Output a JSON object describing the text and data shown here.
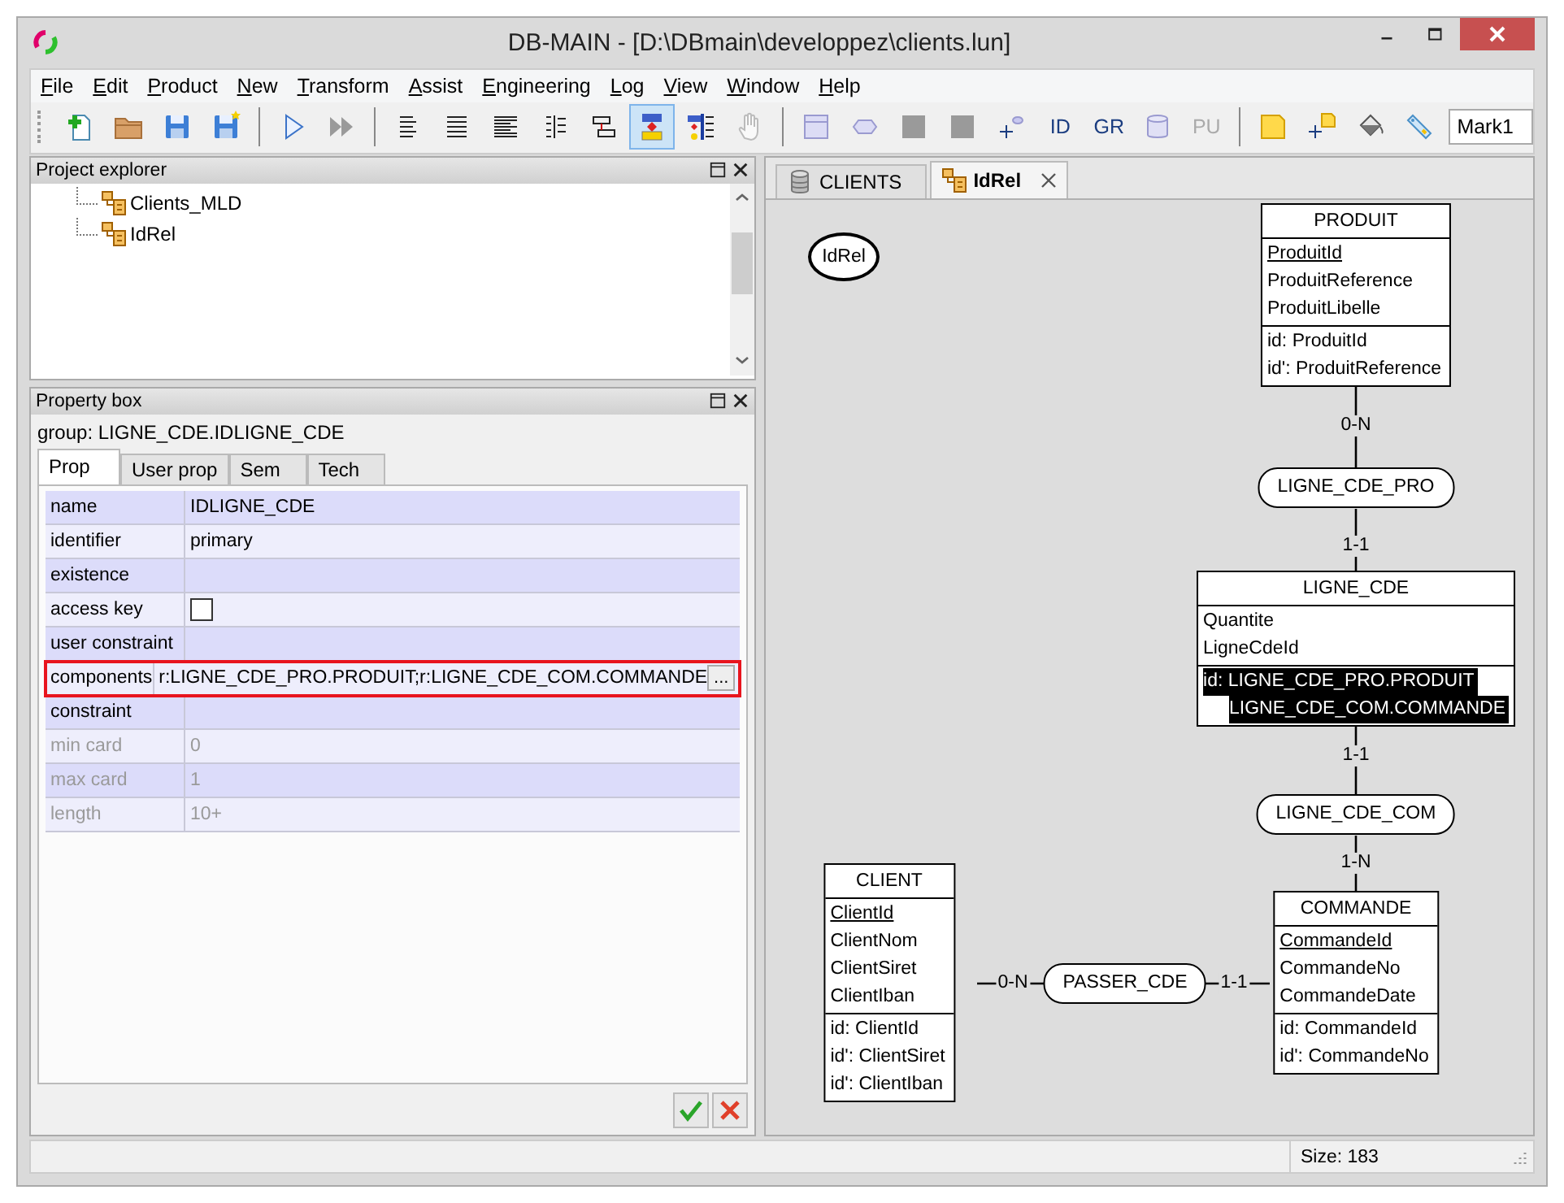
{
  "window": {
    "title": "DB-MAIN  - [D:\\DBmain\\developpez\\clients.lun]"
  },
  "menu": [
    {
      "label": "File"
    },
    {
      "label": "Edit"
    },
    {
      "label": "Product"
    },
    {
      "label": "New"
    },
    {
      "label": "Transform"
    },
    {
      "label": "Assist"
    },
    {
      "label": "Engineering"
    },
    {
      "label": "Log"
    },
    {
      "label": "View"
    },
    {
      "label": "Window"
    },
    {
      "label": "Help"
    }
  ],
  "toolbar": [
    {
      "kind": "icon",
      "selected": false,
      "disabled": false
    },
    {
      "kind": "icon",
      "selected": false,
      "disabled": false
    },
    {
      "kind": "icon",
      "selected": false,
      "disabled": false
    },
    {
      "kind": "icon",
      "selected": false,
      "disabled": false
    },
    {
      "kind": "separator"
    },
    {
      "kind": "icon",
      "selected": false,
      "disabled": false
    },
    {
      "kind": "icon",
      "selected": false,
      "disabled": false
    },
    {
      "kind": "separator"
    },
    {
      "kind": "icon",
      "selected": false,
      "disabled": false
    },
    {
      "kind": "icon",
      "selected": false,
      "disabled": false
    },
    {
      "kind": "icon",
      "selected": false,
      "disabled": false
    },
    {
      "kind": "icon",
      "selected": false,
      "disabled": false
    },
    {
      "kind": "icon",
      "selected": false,
      "disabled": false
    },
    {
      "kind": "icon",
      "selected": true,
      "disabled": false
    },
    {
      "kind": "icon",
      "selected": false,
      "disabled": false
    },
    {
      "kind": "icon",
      "selected": false,
      "disabled": true
    },
    {
      "kind": "separator"
    },
    {
      "kind": "icon",
      "selected": false,
      "disabled": false
    },
    {
      "kind": "icon",
      "selected": false,
      "disabled": false
    },
    {
      "kind": "icon",
      "selected": false,
      "disabled": false
    },
    {
      "kind": "icon",
      "selected": false,
      "disabled": false
    },
    {
      "kind": "icon",
      "selected": false,
      "disabled": false
    },
    {
      "kind": "text",
      "label": "ID",
      "selected": false,
      "disabled": false
    },
    {
      "kind": "text",
      "label": "GR",
      "selected": false,
      "disabled": false
    },
    {
      "kind": "icon",
      "selected": false,
      "disabled": false
    },
    {
      "kind": "text",
      "label": "PU",
      "selected": false,
      "disabled": true
    },
    {
      "kind": "separator"
    },
    {
      "kind": "icon",
      "selected": false,
      "disabled": false
    },
    {
      "kind": "icon",
      "selected": false,
      "disabled": false
    },
    {
      "kind": "icon",
      "selected": false,
      "disabled": false
    },
    {
      "kind": "icon",
      "selected": false,
      "disabled": false
    },
    {
      "kind": "field",
      "value": "Mark1"
    }
  ],
  "project_explorer": {
    "title": "Project explorer",
    "items": [
      {
        "label": "Clients_MLD"
      },
      {
        "label": "IdRel"
      }
    ]
  },
  "property_box": {
    "title": "Property box",
    "subject": "group: LIGNE_CDE.IDLIGNE_CDE",
    "tabs": [
      {
        "label": "Prop",
        "selected": true
      },
      {
        "label": "User prop",
        "selected": false
      },
      {
        "label": "Sem",
        "selected": false
      },
      {
        "label": "Tech",
        "selected": false
      }
    ],
    "rows": [
      {
        "kind": "text",
        "label": "name",
        "value": "IDLIGNE_CDE",
        "disabled": false,
        "highlighted": false
      },
      {
        "kind": "text",
        "label": "identifier",
        "value": "primary",
        "disabled": false,
        "highlighted": false
      },
      {
        "kind": "text",
        "label": "existence",
        "disabled": false,
        "highlighted": false
      },
      {
        "kind": "checkbox",
        "label": "access key",
        "checked": false,
        "disabled": false,
        "highlighted": false
      },
      {
        "kind": "text",
        "label": "user constraint",
        "disabled": false,
        "highlighted": false
      },
      {
        "kind": "list",
        "label": "components",
        "value": "r:LIGNE_CDE_PRO.PRODUIT;r:LIGNE_CDE_COM.COMMANDE",
        "button": "...",
        "disabled": false,
        "highlighted": true
      },
      {
        "kind": "text",
        "label": "constraint",
        "disabled": false,
        "highlighted": false
      },
      {
        "kind": "text",
        "label": "min card",
        "value": "0",
        "disabled": true,
        "highlighted": false
      },
      {
        "kind": "text",
        "label": "max card",
        "value": "1",
        "disabled": true,
        "highlighted": false
      },
      {
        "kind": "text",
        "label": "length",
        "value": "10+",
        "disabled": true,
        "highlighted": false
      }
    ]
  },
  "editor_tabs": [
    {
      "label": "CLIENTS",
      "selected": false,
      "closable": false
    },
    {
      "label": "IdRel",
      "selected": true,
      "closable": true
    }
  ],
  "diagram": {
    "schema": "IdRel",
    "entities": [
      {
        "name": "PRODUIT",
        "attributes": [
          {
            "name": "ProduitId",
            "primary": true
          },
          {
            "name": "ProduitReference",
            "primary": false
          },
          {
            "name": "ProduitLibelle",
            "primary": false
          }
        ],
        "constraints": [
          {
            "lines": [
              "id: ProduitId"
            ],
            "selected": false
          },
          {
            "lines": [
              "id': ProduitReference"
            ],
            "selected": false
          }
        ]
      },
      {
        "name": "LIGNE_CDE",
        "attributes": [
          {
            "name": "Quantite",
            "primary": false
          },
          {
            "name": "LigneCdeId",
            "primary": false
          }
        ],
        "constraints": [
          {
            "lines": [
              "id: LIGNE_CDE_PRO.PRODUIT",
              "LIGNE_CDE_COM.COMMANDE"
            ],
            "selected": true
          }
        ]
      },
      {
        "name": "CLIENT",
        "attributes": [
          {
            "name": "ClientId",
            "primary": true
          },
          {
            "name": "ClientNom",
            "primary": false
          },
          {
            "name": "ClientSiret",
            "primary": false
          },
          {
            "name": "ClientIban",
            "primary": false
          }
        ],
        "constraints": [
          {
            "lines": [
              "id: ClientId"
            ],
            "selected": false
          },
          {
            "lines": [
              "id': ClientSiret"
            ],
            "selected": false
          },
          {
            "lines": [
              "id': ClientIban"
            ],
            "selected": false
          }
        ]
      },
      {
        "name": "COMMANDE",
        "attributes": [
          {
            "name": "CommandeId",
            "primary": true
          },
          {
            "name": "CommandeNo",
            "primary": false
          },
          {
            "name": "CommandeDate",
            "primary": false
          }
        ],
        "constraints": [
          {
            "lines": [
              "id: CommandeId"
            ],
            "selected": false
          },
          {
            "lines": [
              "id': CommandeNo"
            ],
            "selected": false
          }
        ]
      }
    ],
    "relationships": [
      {
        "name": "LIGNE_CDE_PRO",
        "cards": [
          "0-N",
          "1-1"
        ]
      },
      {
        "name": "LIGNE_CDE_COM",
        "cards": [
          "1-1",
          "1-N"
        ]
      },
      {
        "name": "PASSER_CDE",
        "cards": [
          "0-N",
          "1-1"
        ]
      }
    ]
  },
  "status_bar": {
    "size": "Size: 183"
  }
}
